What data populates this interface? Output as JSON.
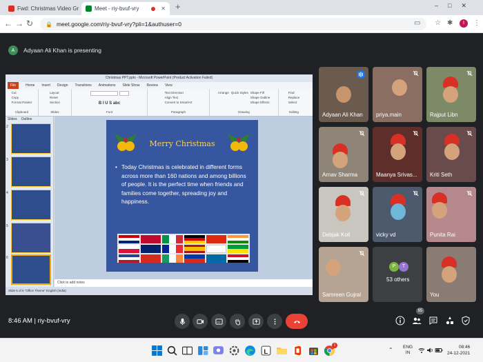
{
  "browser": {
    "tabs": [
      {
        "title": "Fwd: Christmas Video Group A a",
        "active": false,
        "color": "#d93025"
      },
      {
        "title": "Meet - riy-bvuf-vry",
        "active": true,
        "color": "#00832d"
      }
    ],
    "new_tab_label": "+",
    "url": "meet.google.com/riy-bvuf-vry?pli=1&authuser=0",
    "profile_initial": "I"
  },
  "meet": {
    "presenter_initial": "A",
    "presenting_text": "Adyaan Ali Khan is presenting",
    "time": "8:46 AM",
    "separator": "|",
    "meeting_code": "riy-bvuf-vry",
    "participant_count": "65"
  },
  "powerpoint": {
    "window_title": "Christmas PPT.pptx - Microsoft PowerPoint (Product Activation Failed)",
    "menu": [
      "File",
      "Home",
      "Insert",
      "Design",
      "Transitions",
      "Animations",
      "Slide Show",
      "Review",
      "View"
    ],
    "ribbon_groups": [
      "Clipboard",
      "Slides",
      "Font",
      "Paragraph",
      "Drawing",
      "Editing"
    ],
    "ribbon_buttons": {
      "cut": "Cut",
      "copy": "Copy",
      "paste": "Paste",
      "format_painter": "Format Painter",
      "new_slide": "New Slide",
      "layout": "Layout",
      "reset": "Reset",
      "section": "Section",
      "text_direction": "Text Direction",
      "align_text": "Align Text",
      "smartart": "Convert to SmartArt",
      "arrange": "Arrange",
      "quick_styles": "Quick Styles",
      "shape_fill": "Shape Fill",
      "shape_outline": "Shape Outline",
      "shape_effects": "Shape Effects",
      "find": "Find",
      "replace": "Replace",
      "select": "Select"
    },
    "panel_tabs": [
      "Slides",
      "Outline"
    ],
    "thumbnail_numbers": [
      "2",
      "3",
      "4",
      "5",
      "6"
    ],
    "slide_title": "Merry Christmas",
    "slide_bullet": "Today Christmas is celebrated in different forms across more than 160 nations and among billions of people. It is the perfect time when friends and families come together, spreading joy and happiness.",
    "notes_placeholder": "Click to add notes",
    "status_text": "Slide 6 of 6     \"Office Theme\"     English (India)"
  },
  "participants": [
    {
      "name": "Adyaan Ali Khan",
      "bg": "#6b5a4e"
    },
    {
      "name": "priya.main",
      "bg": "#8a6e62"
    },
    {
      "name": "Rajput Libn",
      "bg": "#7d8a68"
    },
    {
      "name": "Arnav Sharma",
      "bg": "#8f8478"
    },
    {
      "name": "Maanya Srivas...",
      "bg": "#5e2e2a"
    },
    {
      "name": "Kriti Seth",
      "bg": "#6a4b4b"
    },
    {
      "name": "Debjak Koli",
      "bg": "#c9c5bf"
    },
    {
      "name": "vicky vd",
      "bg": "#4d5a6e"
    },
    {
      "name": "Punita Rai",
      "bg": "#b5888e"
    },
    {
      "name": "Samreen Gujral",
      "bg": "#b5a493"
    },
    {
      "name": "53 others",
      "bg": "#3c4043"
    },
    {
      "name": "You",
      "bg": "#8a7c72"
    }
  ],
  "others_initials": [
    "P",
    "T"
  ],
  "taskbar": {
    "lang": "ENG",
    "region": "IN",
    "clock_time": "08:46",
    "clock_date": "24-12-2021",
    "chrome_badge": "1"
  }
}
